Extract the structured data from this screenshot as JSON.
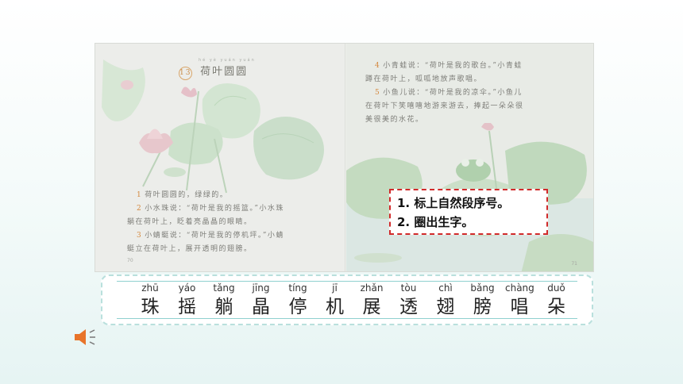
{
  "lesson": {
    "number": "13",
    "title_pinyin": "hé yè yuán yuán",
    "title": "荷叶圆圆",
    "paragraphs": [
      {
        "n": "1",
        "text": "荷叶圆圆的，绿绿的。"
      },
      {
        "n": "2",
        "text": "小水珠说：“荷叶是我的摇篮。”小水珠"
      },
      {
        "n": "",
        "text": "躺在荷叶上，眨着亮晶晶的眼睛。"
      },
      {
        "n": "3",
        "text": "小蜻蜓说：“荷叶是我的停机坪。”小蜻"
      },
      {
        "n": "",
        "text": "蜓立在荷叶上，展开透明的翅膀。"
      },
      {
        "n": "4",
        "text": "小青蛙说：“荷叶是我的歌台。”小青蛙"
      },
      {
        "n": "",
        "text": "蹲在荷叶上，呱呱地放声歌唱。"
      },
      {
        "n": "5",
        "text": "小鱼儿说：“荷叶是我的凉伞。”小鱼儿"
      },
      {
        "n": "",
        "text": "在荷叶下笑嘻嘻地游来游去，捧起一朵朵很"
      },
      {
        "n": "",
        "text": "美很美的水花。"
      }
    ],
    "page_left": "70",
    "page_right": "71"
  },
  "task_box": {
    "line1": "1. 标上自然段序号。",
    "line2": "2. 圈出生字。"
  },
  "characters": [
    {
      "pinyin": "zhū",
      "char": "珠"
    },
    {
      "pinyin": "yáo",
      "char": "摇"
    },
    {
      "pinyin": "tǎng",
      "char": "躺"
    },
    {
      "pinyin": "jīng",
      "char": "晶"
    },
    {
      "pinyin": "tíng",
      "char": "停"
    },
    {
      "pinyin": "jī",
      "char": "机"
    },
    {
      "pinyin": "zhǎn",
      "char": "展"
    },
    {
      "pinyin": "tòu",
      "char": "透"
    },
    {
      "pinyin": "chì",
      "char": "翅"
    },
    {
      "pinyin": "bǎng",
      "char": "膀"
    },
    {
      "pinyin": "chàng",
      "char": "唱"
    },
    {
      "pinyin": "duǒ",
      "char": "朵"
    }
  ],
  "colors": {
    "box_border": "#d12a2a",
    "strip_border": "#b9e0dd",
    "strip_line": "#8fd1cf",
    "speaker": "#e8742a"
  },
  "icons": {
    "audio": "speaker-icon"
  }
}
